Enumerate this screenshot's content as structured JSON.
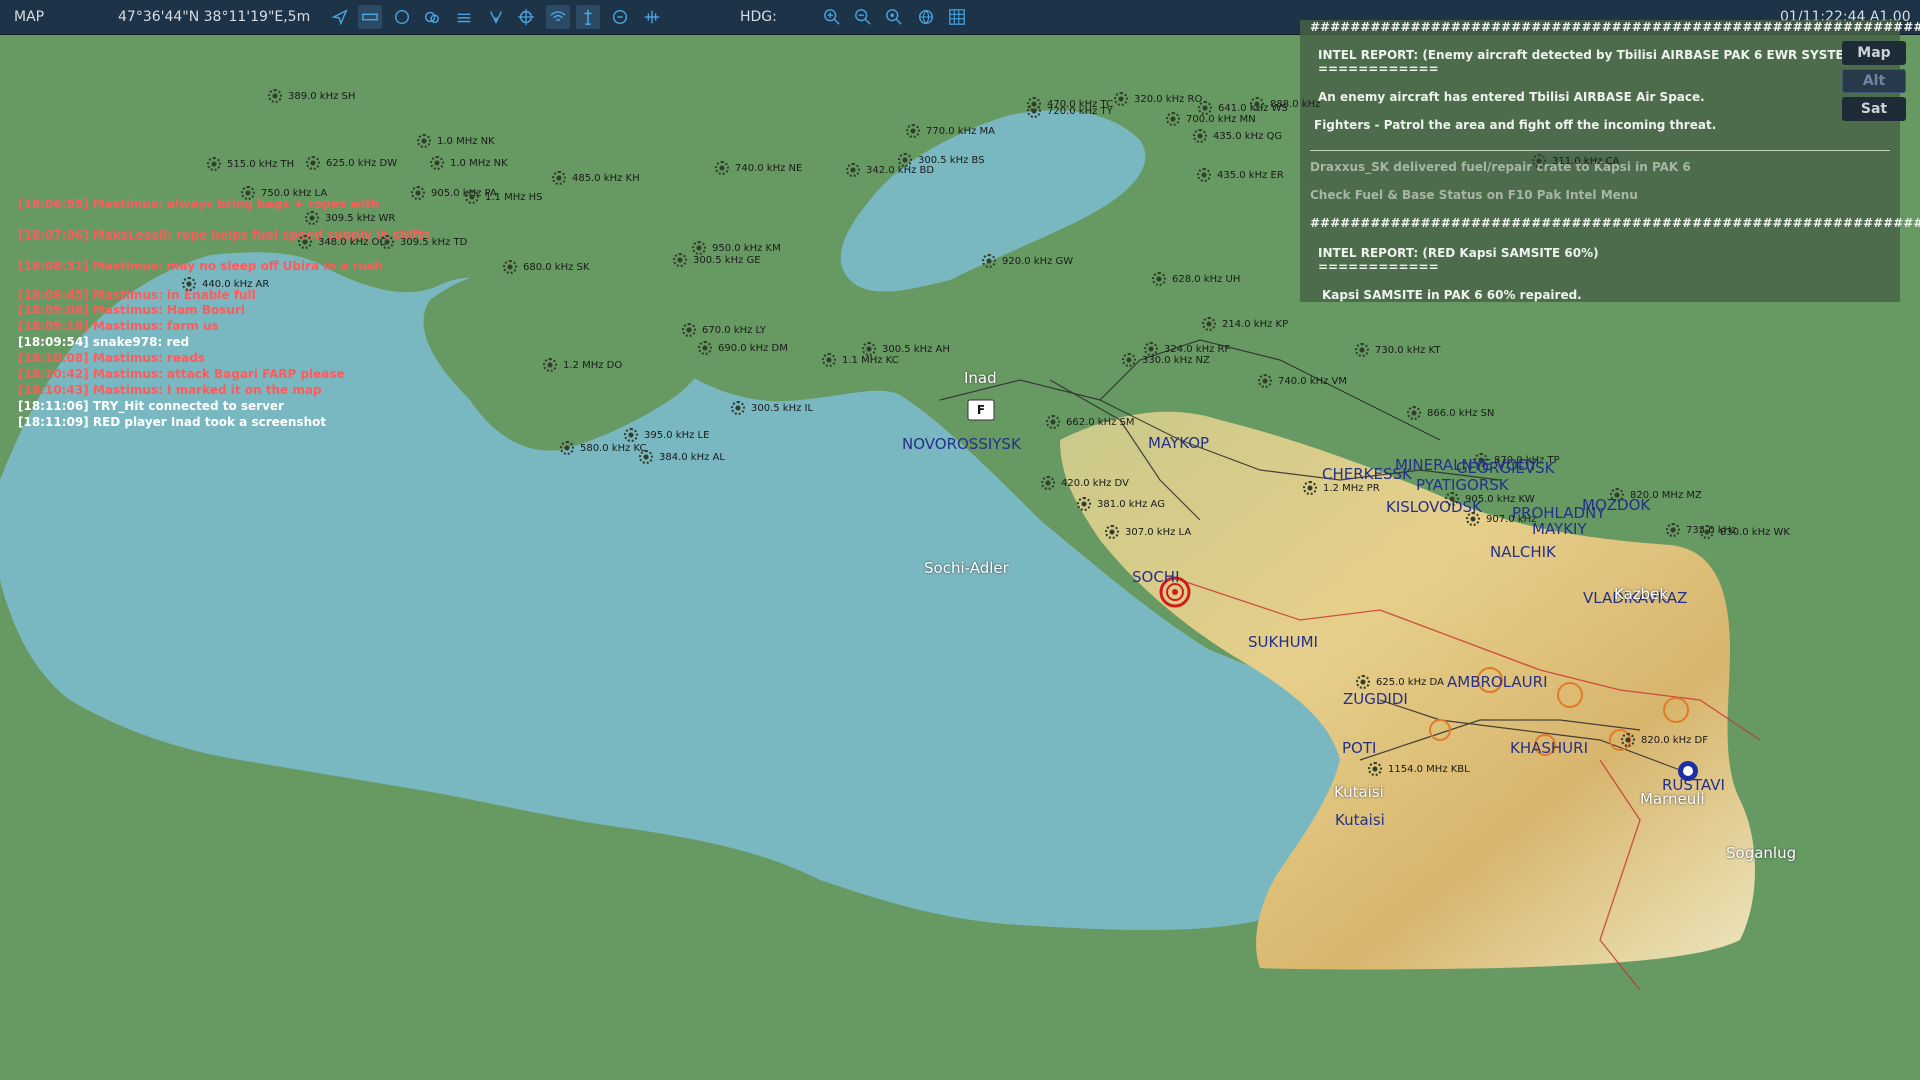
{
  "toolbar": {
    "map_label": "MAP",
    "coords": "47°36'44\"N 38°11'19\"E,5m",
    "hdg_label": "HDG:",
    "datetime": "01/11:22:44 A1.00"
  },
  "intel_panel": {
    "lines": [
      {
        "text": "#################################################################",
        "style": "normal"
      },
      {
        "text": "INTEL REPORT: (Enemy aircraft detected by Tbilisi AIRBASE PAK 6 EWR SYSTEM!)",
        "style": "normal"
      },
      {
        "text": "============",
        "style": "normal"
      },
      {
        "text": "An enemy aircraft has entered Tbilisi AIRBASE Air Space.",
        "style": "normal"
      },
      {
        "text": "Fighters - Patrol the area and fight off the incoming threat.",
        "style": "normal"
      },
      {
        "text": "Draxxus_SK delivered fuel/repair crate to Kapsi in PAK 6",
        "style": "dim"
      },
      {
        "text": "Check Fuel & Base Status on F10 Pak Intel Menu",
        "style": "dim"
      },
      {
        "text": "#################################################################",
        "style": "normal"
      },
      {
        "text": "INTEL REPORT: (RED Kapsi SAMSITE 60%)",
        "style": "normal"
      },
      {
        "text": "============",
        "style": "normal"
      },
      {
        "text": "Kapsi SAMSITE in PAK 6 60% repaired.",
        "style": "normal"
      }
    ]
  },
  "view_buttons": [
    "Map",
    "Alt",
    "Sat"
  ],
  "chat": [
    {
      "text": "[18:06:55] Mastimus: always bring bags + ropes with",
      "color": "red"
    },
    {
      "text": "[18:07:06] MaksLeasil: rope helps fuel speed supply in shifts",
      "color": "red"
    },
    {
      "text": "[18:08:31] Mastimus: may no sleep off Ubira in a rush",
      "color": "red"
    },
    {
      "text": "[18:08:45] Mastimus: in Enable full",
      "color": "red"
    },
    {
      "text": "[18:09:08] Mastimus: Ham Bosuri",
      "color": "red"
    },
    {
      "text": "[18:09:18] Mastimus: farm us",
      "color": "red"
    },
    {
      "text": "[18:09:54] snake978: red",
      "color": "white"
    },
    {
      "text": "[18:10:08] Mastimus: reads",
      "color": "red"
    },
    {
      "text": "[18:10:42] Mastimus: attack Bagari FARP please",
      "color": "red"
    },
    {
      "text": "[18:10:43] Mastimus: I marked it on the map",
      "color": "red"
    },
    {
      "text": "[18:11:06] TRY_Hit connected to server",
      "color": "white"
    },
    {
      "text": "[18:11:09] RED player Inad took a screenshot",
      "color": "white"
    }
  ],
  "beacons": [
    "389.0 kHz SH",
    "1.0 MHz NK",
    "1.0 MHz NK",
    "515.0 kHz TH",
    "625.0 kHz DW",
    "750.0 kHz LA",
    "905.0 kHz PA",
    "1.1 MHz HS",
    "485.0 kHz KH",
    "309.5 kHz WR",
    "348.0 kHz OC",
    "309.5 kHz TD",
    "440.0 kHz AR",
    "680.0 kHz SK",
    "950.0 kHz KM",
    "300.5 kHz GE",
    "740.0 kHz NE",
    "770.0 kHz MA",
    "342.0 kHz BD",
    "300.5 kHz BS",
    "470.0 kHz TC",
    "720.0 kHz TY",
    "320.0 kHz RO",
    "641.0 kHz WS",
    "700.0 kHz MN",
    "888.0 kHz",
    "435.0 kHz QG",
    "435.0 kHz ER",
    "920.0 kHz GW",
    "670.0 kHz LY",
    "690.0 kHz DM",
    "1.2 MHz DO",
    "300.5 kHz AH",
    "1.1 MHz KC",
    "300.5 kHz IL",
    "395.0 kHz LE",
    "580.0 kHz KC",
    "384.0 kHz AL",
    "628.0 kHz UH",
    "214.0 kHz KP",
    "324.0 kHz RF",
    "330.0 kHz NZ",
    "740.0 kHz VM",
    "730.0 kHz KT",
    "866.0 kHz SN",
    "662.0 kHz SM",
    "420.0 kHz DV",
    "381.0 kHz AG",
    "307.0 kHz LA",
    "1.2 MHz PR",
    "905.0 kHz KW",
    "907.0 kHz",
    "820.0 MHz MZ",
    "735.0 kHz",
    "830.0 kHz WK",
    "625.0 kHz DA",
    "1154.0 MHz KBL",
    "311.0 kHz CA",
    "870.0 kHz TP",
    "820.0 kHz DF"
  ],
  "cities": [
    "NOVOROSSIYSK",
    "MAYKOP",
    "CHERKESSK",
    "MINERALNYE VODY",
    "GEORGIEVSK",
    "PYATIGORSK",
    "KISLOVODSK",
    "PROHLADNY",
    "MOZDOK",
    "MAYKIY",
    "NALCHIK",
    "VLADIKAVKAZ",
    "SOCHI",
    "SUKHUMI",
    "ZUGDIDI",
    "AMBROLAURI",
    "POTI",
    "KHASHURI",
    "RUSTAVI",
    "Kutaisi"
  ],
  "places": [
    "Inad",
    "Sochi-Adler",
    "Soganlug",
    "Kutaisi",
    "Marneuli",
    "Kazbek"
  ]
}
